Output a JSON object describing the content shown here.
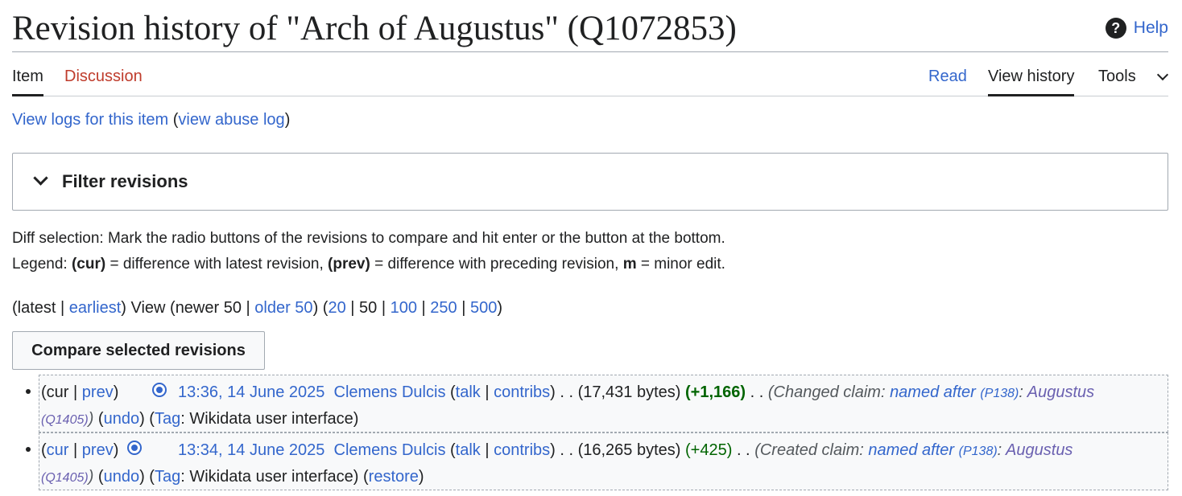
{
  "header": {
    "title": "Revision history of \"Arch of Augustus\" (Q1072853)",
    "help_label": "Help"
  },
  "tabs": {
    "item": "Item",
    "discussion": "Discussion",
    "read": "Read",
    "view_history": "View history",
    "tools": "Tools"
  },
  "logs": {
    "view_logs": "View logs for this item",
    "open_paren": " (",
    "abuse_log": "view abuse log",
    "close_paren": ")"
  },
  "filter": {
    "label": "Filter revisions"
  },
  "info": {
    "diff_selection": "Diff selection: Mark the radio buttons of the revisions to compare and hit enter or the button at the bottom.",
    "legend_prefix": "Legend: ",
    "cur_bold": "(cur)",
    "cur_text": " = difference with latest revision, ",
    "prev_bold": "(prev)",
    "prev_text": " = difference with preceding revision, ",
    "m_bold": "m",
    "m_text": " = minor edit."
  },
  "nav": {
    "open_latest": "(latest | ",
    "earliest": "earliest",
    "view_newer": ") View (newer 50 | ",
    "older": "older 50",
    "close_open": ") (",
    "n20": "20",
    "sep_50": " | 50 | ",
    "n100": "100",
    "sep1": " | ",
    "n250": "250",
    "sep2": " | ",
    "n500": "500",
    "close": ")"
  },
  "compare_button": "Compare selected revisions",
  "revisions": [
    {
      "cur": "cur",
      "prev": "prev",
      "timestamp": "13:36, 14 June 2025",
      "user": "Clemens Dulcis",
      "talk": "talk",
      "contribs": "contribs",
      "size": "(17,431 bytes)",
      "diff": "(+1,166)",
      "summary_prefix": "(Changed claim: ",
      "property": "named after",
      "property_id": "(P138)",
      "value": "Augustus",
      "value_id": "(Q1405)",
      "undo": "undo",
      "tag_label": "Tag",
      "tag_value": ": Wikidata user interface)",
      "restore": ""
    },
    {
      "cur": "cur",
      "prev": "prev",
      "timestamp": "13:34, 14 June 2025",
      "user": "Clemens Dulcis",
      "talk": "talk",
      "contribs": "contribs",
      "size": "(16,265 bytes)",
      "diff": "(+425)",
      "summary_prefix": "(Created claim: ",
      "property": "named after",
      "property_id": "(P138)",
      "value": "Augustus",
      "value_id": "(Q1405)",
      "undo": "undo",
      "tag_label": "Tag",
      "tag_value": ": Wikidata user interface)",
      "restore": "restore"
    }
  ]
}
